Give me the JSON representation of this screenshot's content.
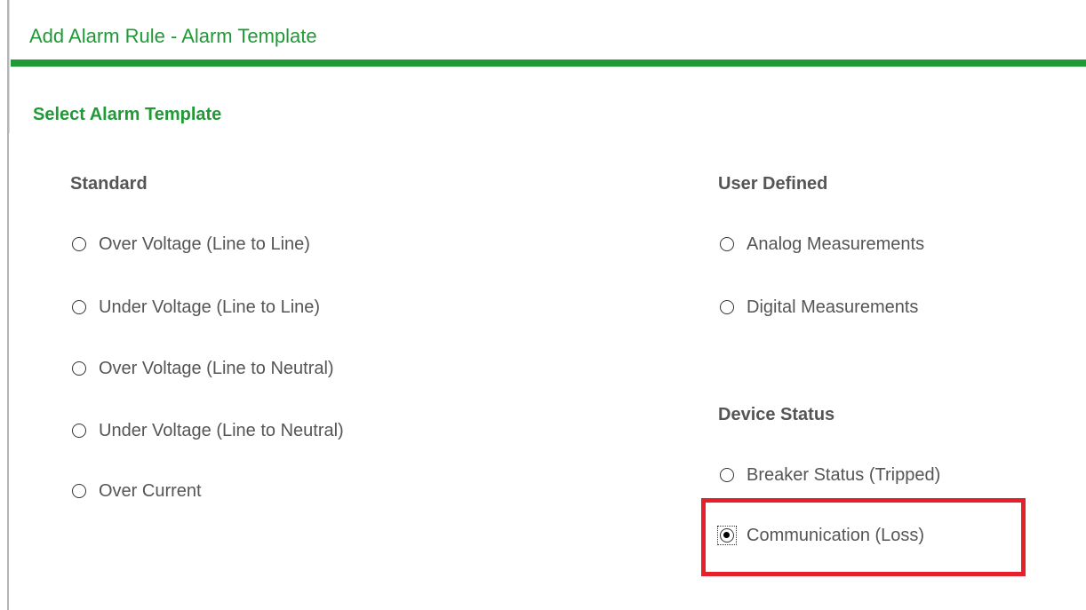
{
  "dialog": {
    "title": "Add Alarm Rule - Alarm Template",
    "section_heading": "Select Alarm Template"
  },
  "groups": {
    "standard": {
      "heading": "Standard",
      "options": [
        {
          "label": "Over Voltage (Line to Line)",
          "checked": false
        },
        {
          "label": "Under Voltage (Line to Line)",
          "checked": false
        },
        {
          "label": "Over Voltage (Line to Neutral)",
          "checked": false
        },
        {
          "label": "Under Voltage (Line to Neutral)",
          "checked": false
        },
        {
          "label": "Over Current",
          "checked": false
        }
      ]
    },
    "user_defined": {
      "heading": "User Defined",
      "options": [
        {
          "label": "Analog Measurements",
          "checked": false
        },
        {
          "label": "Digital Measurements",
          "checked": false
        }
      ]
    },
    "device_status": {
      "heading": "Device Status",
      "options": [
        {
          "label": "Breaker Status (Tripped)",
          "checked": false
        },
        {
          "label": "Communication (Loss)",
          "checked": true
        }
      ]
    }
  },
  "colors": {
    "accent_green": "#1f9a37",
    "highlight_red": "#e5202a",
    "text_gray": "#555555"
  }
}
